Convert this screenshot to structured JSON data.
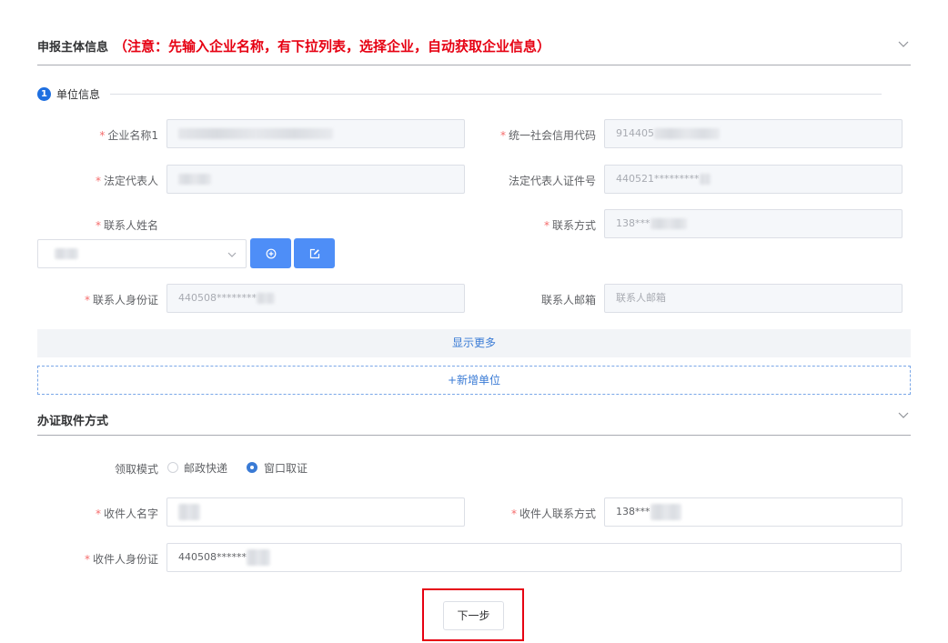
{
  "section1": {
    "title": "申报主体信息",
    "note": "（注意：先输入企业名称，有下拉列表，选择企业，自动获取企业信息）"
  },
  "step": {
    "number": "1",
    "title": "单位信息"
  },
  "fields": {
    "company_name": {
      "label": "企业名称1",
      "required": "*"
    },
    "credit_code": {
      "label": "统一社会信用代码",
      "required": "*",
      "value": "914405"
    },
    "legal_rep": {
      "label": "法定代表人",
      "required": "*"
    },
    "legal_rep_id": {
      "label": "法定代表人证件号",
      "value": "440521*********"
    },
    "contact_name": {
      "label": "联系人姓名",
      "required": "*"
    },
    "contact_phone": {
      "label": "联系方式",
      "required": "*",
      "value": "138***"
    },
    "contact_id": {
      "label": "联系人身份证",
      "required": "*",
      "value": "440508********"
    },
    "contact_email": {
      "label": "联系人邮箱",
      "placeholder": "联系人邮箱"
    }
  },
  "actions": {
    "add_icon": "plus-circle-icon",
    "edit_icon": "edit-icon",
    "show_more": "显示更多",
    "add_unit": "+新增单位"
  },
  "section2": {
    "title": "办证取件方式"
  },
  "pickup": {
    "mode_label": "领取模式",
    "options": [
      "邮政快递",
      "窗口取证"
    ],
    "selected": "窗口取证"
  },
  "recipient": {
    "name": {
      "label": "收件人名字",
      "required": "*"
    },
    "phone": {
      "label": "收件人联系方式",
      "required": "*",
      "value": "138***"
    },
    "id": {
      "label": "收件人身份证",
      "required": "*",
      "value": "440508******"
    }
  },
  "next_button": "下一步",
  "colors": {
    "accent": "#4e8ef7",
    "warning": "#e60012",
    "required": "#f56c6c"
  }
}
